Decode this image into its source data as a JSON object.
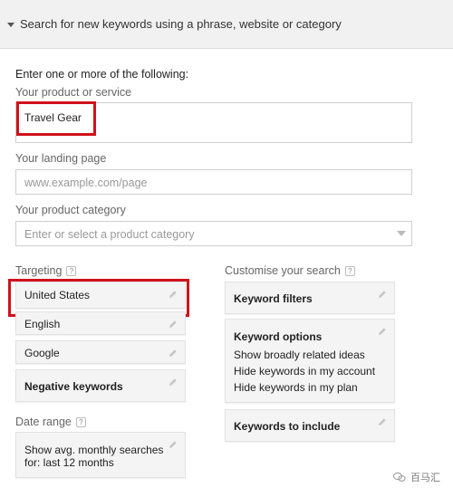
{
  "header": {
    "title": "Search for new keywords using a phrase, website or category"
  },
  "form": {
    "intro": "Enter one or more of the following:",
    "product_label": "Your product or service",
    "product_value": "Travel Gear",
    "landing_label": "Your landing page",
    "landing_placeholder": "www.example.com/page",
    "category_label": "Your product category",
    "category_placeholder": "Enter or select a product category"
  },
  "targeting": {
    "label": "Targeting",
    "help": "?",
    "location": "United States",
    "language": "English",
    "network": "Google",
    "negative": "Negative keywords"
  },
  "date_range": {
    "label": "Date range",
    "help": "?",
    "text": "Show avg. monthly searches for: last 12 months"
  },
  "customise": {
    "label": "Customise your search",
    "help": "?",
    "filters": "Keyword filters",
    "options_title": "Keyword options",
    "options_items": [
      "Show broadly related ideas",
      "Hide keywords in my account",
      "Hide keywords in my plan"
    ],
    "include": "Keywords to include"
  },
  "watermark": {
    "text": "百马汇"
  },
  "colors": {
    "highlight": "#d0121b",
    "card_bg": "#f4f4f4",
    "header_bg": "#f1f1f1"
  }
}
